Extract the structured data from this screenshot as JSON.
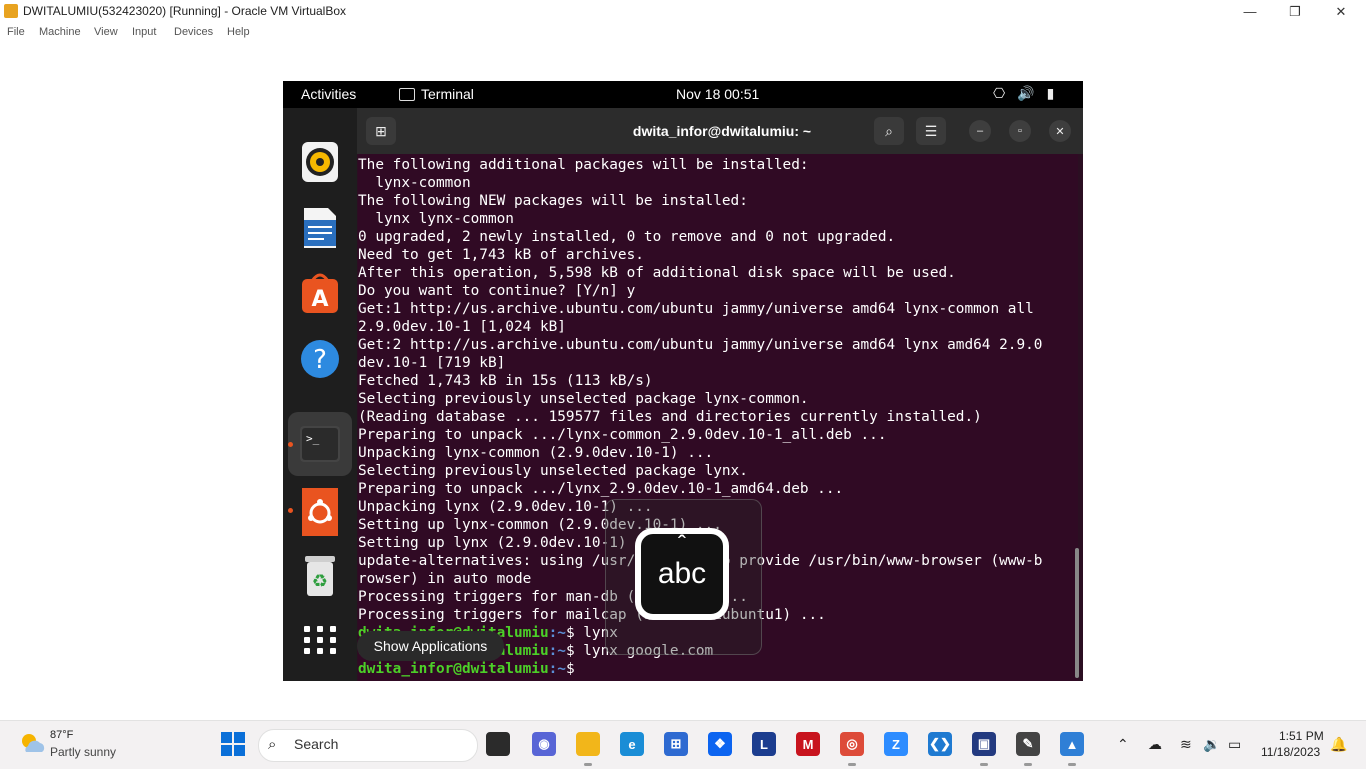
{
  "host_window": {
    "title": "DWITALUMIU(532423020) [Running] - Oracle VM VirtualBox",
    "controls": {
      "minimize": "—",
      "restore": "❐",
      "close": "✕"
    },
    "menu": [
      "File",
      "Machine",
      "View",
      "Input",
      "Devices",
      "Help"
    ]
  },
  "gnome_topbar": {
    "activities": "Activities",
    "app_name": "Terminal",
    "datetime": "Nov 18  00:51",
    "tray": {
      "network": "⎔",
      "volume": "🔊",
      "battery": "▮"
    }
  },
  "dock": {
    "items": [
      "rhythmbox-icon",
      "libreoffice-writer-icon",
      "ubuntu-software-icon",
      "help-icon",
      "terminal-icon",
      "ubuntu-icon",
      "trash-icon",
      "show-apps-icon"
    ],
    "tooltip": "Show Applications"
  },
  "terminal": {
    "title": "dwita_infor@dwitalumiu: ~",
    "buttons": {
      "new_tab": "⊞",
      "search": "⌕",
      "menu": "☰",
      "minimize": "–",
      "maximize": "▫",
      "close": "✕"
    },
    "lines": [
      "The following additional packages will be installed:",
      "  lynx-common",
      "The following NEW packages will be installed:",
      "  lynx lynx-common",
      "0 upgraded, 2 newly installed, 0 to remove and 0 not upgraded.",
      "Need to get 1,743 kB of archives.",
      "After this operation, 5,598 kB of additional disk space will be used.",
      "Do you want to continue? [Y/n] y",
      "Get:1 http://us.archive.ubuntu.com/ubuntu jammy/universe amd64 lynx-common all",
      "2.9.0dev.10-1 [1,024 kB]",
      "Get:2 http://us.archive.ubuntu.com/ubuntu jammy/universe amd64 lynx amd64 2.9.0",
      "dev.10-1 [719 kB]",
      "Fetched 1,743 kB in 15s (113 kB/s)",
      "Selecting previously unselected package lynx-common.",
      "(Reading database ... 159577 files and directories currently installed.)",
      "Preparing to unpack .../lynx-common_2.9.0dev.10-1_all.deb ...",
      "Unpacking lynx-common (2.9.0dev.10-1) ...",
      "Selecting previously unselected package lynx.",
      "Preparing to unpack .../lynx_2.9.0dev.10-1_amd64.deb ...",
      "Unpacking lynx (2.9.0dev.10-1) ...",
      "Setting up lynx-common (2.9.0dev.10-1) ...",
      "Setting up lynx (2.9.0dev.10-1) ...",
      "update-alternatives: using /usr/bin/lynx to provide /usr/bin/www-browser (www-b",
      "rowser) in auto mode",
      "Processing triggers for man-db (2.10.2-1) ...",
      "Processing triggers for mailcap (3.70+nmu1ubuntu1) ..."
    ],
    "prompt_user": "dwita_infor@dwitalumiu",
    "prompt_path": ":~",
    "prompt_sign": "$ ",
    "commands": [
      "lynx",
      "lynx google.com",
      ""
    ]
  },
  "ime_popup": {
    "caret": "ˆ",
    "label": "abc"
  },
  "taskbar": {
    "weather_temp": "87°F",
    "weather_desc": "Partly sunny",
    "search_placeholder": "Search",
    "apps": [
      {
        "name": "task-view",
        "glyph": "",
        "color": "#2b2b2b"
      },
      {
        "name": "chat",
        "glyph": "◉",
        "color": "#5865d6"
      },
      {
        "name": "file-explorer",
        "glyph": "",
        "color": "#f2b61a"
      },
      {
        "name": "edge",
        "glyph": "e",
        "color": "#1a8dd6"
      },
      {
        "name": "store",
        "glyph": "⊞",
        "color": "#2e6ad1"
      },
      {
        "name": "dropbox",
        "glyph": "❖",
        "color": "#0c64f0"
      },
      {
        "name": "l-app",
        "glyph": "L",
        "color": "#1c3d8f"
      },
      {
        "name": "mcafee",
        "glyph": "M",
        "color": "#c8141e"
      },
      {
        "name": "chrome",
        "glyph": "◎",
        "color": "#dd4b39"
      },
      {
        "name": "zoom",
        "glyph": "Z",
        "color": "#2d8cff"
      },
      {
        "name": "vscode",
        "glyph": "❮❯",
        "color": "#1f7ad1"
      },
      {
        "name": "virtualbox",
        "glyph": "▣",
        "color": "#233a80"
      },
      {
        "name": "pen-app",
        "glyph": "✎",
        "color": "#444444"
      },
      {
        "name": "photos",
        "glyph": "▲",
        "color": "#2f7fd6"
      }
    ],
    "tray": {
      "chevron": "⌃",
      "cloud": "☁",
      "wifi": "≋",
      "volume": "🔉",
      "battery": "▭",
      "bell": "🔔"
    },
    "time": "1:51 PM",
    "date": "11/18/2023"
  }
}
